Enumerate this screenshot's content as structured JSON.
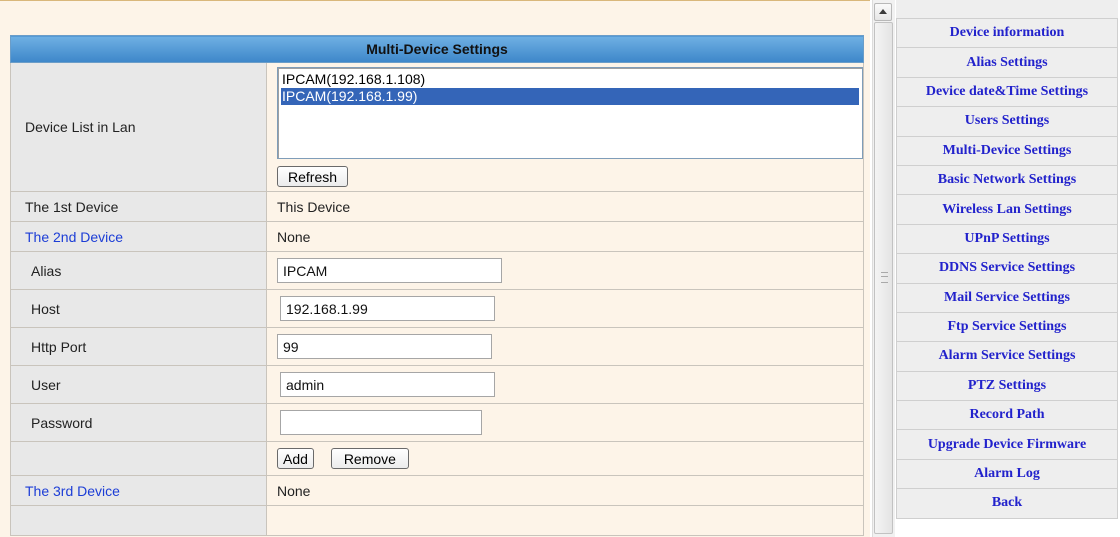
{
  "section": {
    "header": "Multi-Device Settings"
  },
  "device_list": {
    "label": "Device List in Lan",
    "options": [
      "IPCAM(192.168.1.108)",
      "IPCAM(192.168.1.99)"
    ],
    "selected_index": 1,
    "refresh_label": "Refresh"
  },
  "first_device": {
    "label": "The 1st Device",
    "value": "This Device"
  },
  "second_device": {
    "label": "The 2nd Device",
    "value": "None",
    "alias_label": "Alias",
    "alias_value": "IPCAM",
    "host_label": "Host",
    "host_value": "192.168.1.99",
    "port_label": "Http Port",
    "port_value": "99",
    "user_label": "User",
    "user_value": "admin",
    "password_label": "Password",
    "password_value": "",
    "add_label": "Add",
    "remove_label": "Remove"
  },
  "third_device": {
    "label": "The 3rd Device",
    "value": "None"
  },
  "menu": {
    "items": [
      "Device information",
      "Alias Settings",
      "Device date&Time Settings",
      "Users Settings",
      "Multi-Device Settings",
      "Basic Network Settings",
      "Wireless Lan Settings",
      "UPnP Settings",
      "DDNS Service Settings",
      "Mail Service Settings",
      "Ftp Service Settings",
      "Alarm Service Settings",
      "PTZ Settings",
      "Record Path",
      "Upgrade Device Firmware",
      "Alarm Log",
      "Back"
    ]
  },
  "colors": {
    "header_blue": "#3d86c9",
    "link_blue": "#2222cc",
    "selection": "#3465b8",
    "panel_bg": "#fdf4e8"
  }
}
